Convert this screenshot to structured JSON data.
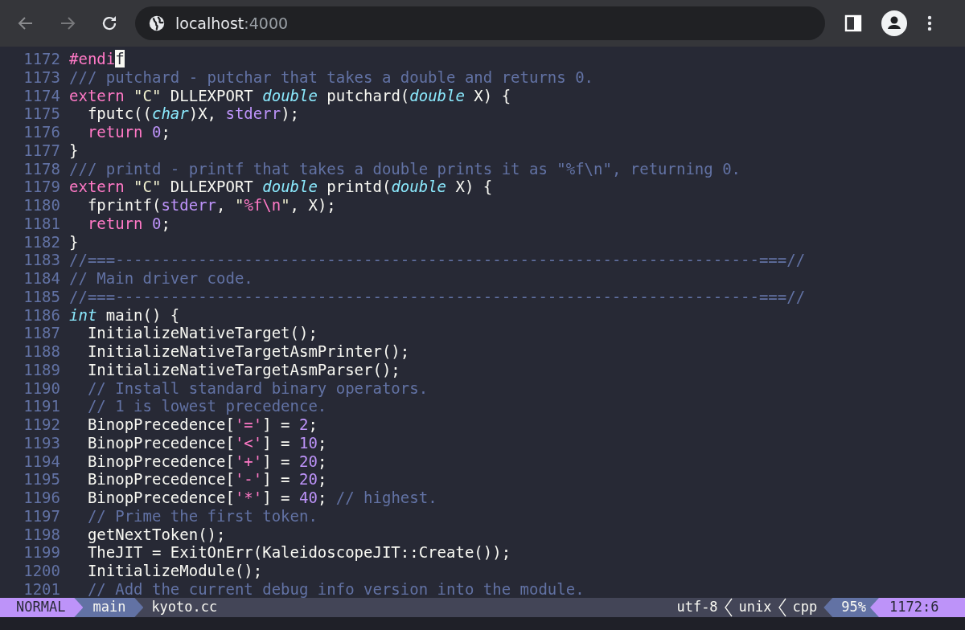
{
  "browser": {
    "url_host": "localhost",
    "url_port": ":4000"
  },
  "editor": {
    "lines": [
      {
        "number": "1172",
        "tokens": [
          {
            "kind": "keyword",
            "text": "#endi"
          },
          {
            "kind": "cursor",
            "text": "f"
          }
        ]
      },
      {
        "number": "1173",
        "tokens": [
          {
            "kind": "comment",
            "text": "/// putchard - putchar that takes a double and returns 0."
          }
        ]
      },
      {
        "number": "1174",
        "tokens": [
          {
            "kind": "keyword",
            "text": "extern"
          },
          {
            "kind": "string",
            "text": " \"C\""
          },
          {
            "kind": "plain",
            "text": " DLLEXPORT "
          },
          {
            "kind": "type",
            "text": "double"
          },
          {
            "kind": "plain",
            "text": " putchard("
          },
          {
            "kind": "type",
            "text": "double"
          },
          {
            "kind": "plain",
            "text": " X) {"
          }
        ]
      },
      {
        "number": "1175",
        "tokens": [
          {
            "kind": "plain",
            "text": "  fputc(("
          },
          {
            "kind": "type",
            "text": "char"
          },
          {
            "kind": "plain",
            "text": ")X, "
          },
          {
            "kind": "variable",
            "text": "stderr"
          },
          {
            "kind": "plain",
            "text": ");"
          }
        ]
      },
      {
        "number": "1176",
        "tokens": [
          {
            "kind": "keyword",
            "text": "  return"
          },
          {
            "kind": "number",
            "text": " 0"
          },
          {
            "kind": "plain",
            "text": ";"
          }
        ]
      },
      {
        "number": "1177",
        "tokens": [
          {
            "kind": "plain",
            "text": "}"
          }
        ]
      },
      {
        "number": "1178",
        "tokens": [
          {
            "kind": "comment",
            "text": "/// printd - printf that takes a double prints it as \"%f\\n\", returning 0."
          }
        ]
      },
      {
        "number": "1179",
        "tokens": [
          {
            "kind": "keyword",
            "text": "extern"
          },
          {
            "kind": "string",
            "text": " \"C\""
          },
          {
            "kind": "plain",
            "text": " DLLEXPORT "
          },
          {
            "kind": "type",
            "text": "double"
          },
          {
            "kind": "plain",
            "text": " printd("
          },
          {
            "kind": "type",
            "text": "double"
          },
          {
            "kind": "plain",
            "text": " X) {"
          }
        ]
      },
      {
        "number": "1180",
        "tokens": [
          {
            "kind": "plain",
            "text": "  fprintf("
          },
          {
            "kind": "variable",
            "text": "stderr"
          },
          {
            "kind": "plain",
            "text": ", "
          },
          {
            "kind": "string",
            "text": "\""
          },
          {
            "kind": "special",
            "text": "%f\\n"
          },
          {
            "kind": "string",
            "text": "\""
          },
          {
            "kind": "plain",
            "text": ", X);"
          }
        ]
      },
      {
        "number": "1181",
        "tokens": [
          {
            "kind": "keyword",
            "text": "  return"
          },
          {
            "kind": "number",
            "text": " 0"
          },
          {
            "kind": "plain",
            "text": ";"
          }
        ]
      },
      {
        "number": "1182",
        "tokens": [
          {
            "kind": "plain",
            "text": "}"
          }
        ]
      },
      {
        "number": "1183",
        "tokens": [
          {
            "kind": "comment",
            "text": "//===----------------------------------------------------------------------===//"
          }
        ]
      },
      {
        "number": "1184",
        "tokens": [
          {
            "kind": "comment",
            "text": "// Main driver code."
          }
        ]
      },
      {
        "number": "1185",
        "tokens": [
          {
            "kind": "comment",
            "text": "//===----------------------------------------------------------------------===//"
          }
        ]
      },
      {
        "number": "1186",
        "tokens": [
          {
            "kind": "type",
            "text": "int"
          },
          {
            "kind": "plain",
            "text": " main() {"
          }
        ]
      },
      {
        "number": "1187",
        "tokens": [
          {
            "kind": "plain",
            "text": "  InitializeNativeTarget();"
          }
        ]
      },
      {
        "number": "1188",
        "tokens": [
          {
            "kind": "plain",
            "text": "  InitializeNativeTargetAsmPrinter();"
          }
        ]
      },
      {
        "number": "1189",
        "tokens": [
          {
            "kind": "plain",
            "text": "  InitializeNativeTargetAsmParser();"
          }
        ]
      },
      {
        "number": "1190",
        "tokens": [
          {
            "kind": "comment",
            "text": "  // Install standard binary operators."
          }
        ]
      },
      {
        "number": "1191",
        "tokens": [
          {
            "kind": "comment",
            "text": "  // 1 is lowest precedence."
          }
        ]
      },
      {
        "number": "1192",
        "tokens": [
          {
            "kind": "plain",
            "text": "  BinopPrecedence["
          },
          {
            "kind": "special",
            "text": "'='"
          },
          {
            "kind": "plain",
            "text": "] = "
          },
          {
            "kind": "number",
            "text": "2"
          },
          {
            "kind": "plain",
            "text": ";"
          }
        ]
      },
      {
        "number": "1193",
        "tokens": [
          {
            "kind": "plain",
            "text": "  BinopPrecedence["
          },
          {
            "kind": "special",
            "text": "'<'"
          },
          {
            "kind": "plain",
            "text": "] = "
          },
          {
            "kind": "number",
            "text": "10"
          },
          {
            "kind": "plain",
            "text": ";"
          }
        ]
      },
      {
        "number": "1194",
        "tokens": [
          {
            "kind": "plain",
            "text": "  BinopPrecedence["
          },
          {
            "kind": "special",
            "text": "'+'"
          },
          {
            "kind": "plain",
            "text": "] = "
          },
          {
            "kind": "number",
            "text": "20"
          },
          {
            "kind": "plain",
            "text": ";"
          }
        ]
      },
      {
        "number": "1195",
        "tokens": [
          {
            "kind": "plain",
            "text": "  BinopPrecedence["
          },
          {
            "kind": "special",
            "text": "'-'"
          },
          {
            "kind": "plain",
            "text": "] = "
          },
          {
            "kind": "number",
            "text": "20"
          },
          {
            "kind": "plain",
            "text": ";"
          }
        ]
      },
      {
        "number": "1196",
        "tokens": [
          {
            "kind": "plain",
            "text": "  BinopPrecedence["
          },
          {
            "kind": "special",
            "text": "'*'"
          },
          {
            "kind": "plain",
            "text": "] = "
          },
          {
            "kind": "number",
            "text": "40"
          },
          {
            "kind": "plain",
            "text": "; "
          },
          {
            "kind": "comment",
            "text": "// highest."
          }
        ]
      },
      {
        "number": "1197",
        "tokens": [
          {
            "kind": "comment",
            "text": "  // Prime the first token."
          }
        ]
      },
      {
        "number": "1198",
        "tokens": [
          {
            "kind": "plain",
            "text": "  getNextToken();"
          }
        ]
      },
      {
        "number": "1199",
        "tokens": [
          {
            "kind": "plain",
            "text": "  TheJIT = ExitOnErr(KaleidoscopeJIT::Create());"
          }
        ]
      },
      {
        "number": "1200",
        "tokens": [
          {
            "kind": "plain",
            "text": "  InitializeModule();"
          }
        ]
      },
      {
        "number": "1201",
        "tokens": [
          {
            "kind": "comment",
            "text": "  // Add the current debug info version into the module."
          }
        ]
      }
    ]
  },
  "status_bar": {
    "mode": "NORMAL",
    "branch": "main",
    "file": "kyoto.cc",
    "encoding": "utf-8",
    "format": "unix",
    "filetype": "cpp",
    "percent": "95%",
    "position": "1172:6"
  }
}
